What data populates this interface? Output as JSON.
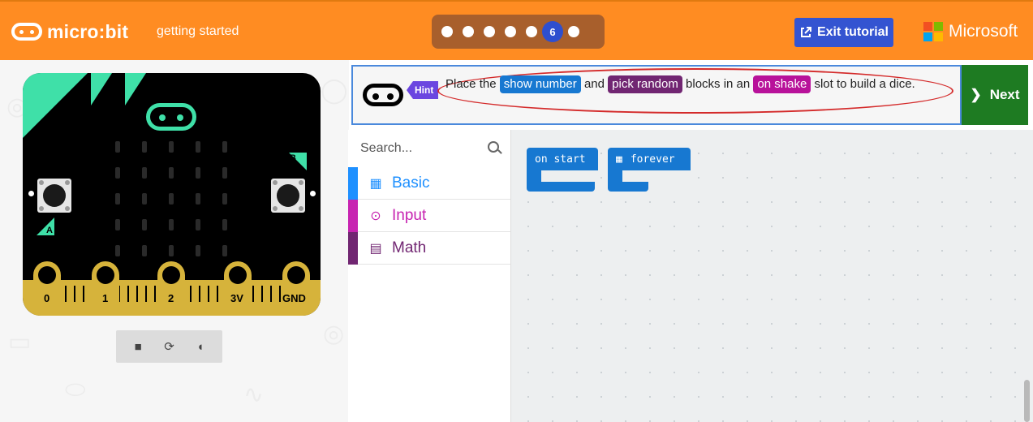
{
  "header": {
    "logo_text": "micro:bit",
    "project_name": "getting started",
    "tutorial_steps": {
      "total": 7,
      "current": 6,
      "current_label": "6"
    },
    "exit_label": "Exit tutorial",
    "brand": "Microsoft"
  },
  "simulator": {
    "button_a": "A",
    "button_b": "B",
    "pins": [
      "0",
      "1",
      "2",
      "3V",
      "GND"
    ],
    "controls": [
      "stop-icon",
      "restart-icon",
      "slow-motion-icon"
    ]
  },
  "hint": {
    "badge": "Hint",
    "text_1": "Place the",
    "chip_1": "show number",
    "text_2": "and",
    "chip_2": "pick random",
    "text_3": "blocks in an",
    "chip_3": "on shake",
    "text_4": "slot to build a dice."
  },
  "next_label": "Next",
  "toolbox": {
    "search_placeholder": "Search...",
    "categories": [
      {
        "label": "Basic",
        "color": "#1e90ff"
      },
      {
        "label": "Input",
        "color": "#c724b1"
      },
      {
        "label": "Math",
        "color": "#712672"
      }
    ]
  },
  "workspace": {
    "blocks": [
      {
        "label": "on start",
        "color": "#1778d1"
      },
      {
        "label": "forever",
        "color": "#1778d1"
      }
    ]
  },
  "colors": {
    "header": "#ff8c22",
    "chip_basic": "#1778d1",
    "chip_math": "#712672",
    "chip_input": "#b8119a",
    "next": "#1e7b22"
  }
}
